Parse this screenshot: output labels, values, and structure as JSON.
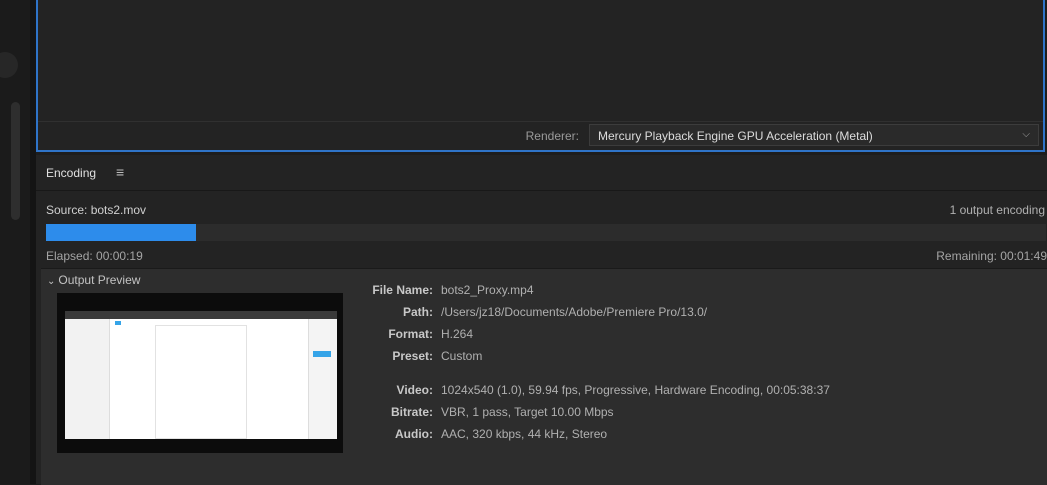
{
  "renderer": {
    "label": "Renderer:",
    "value": "Mercury Playback Engine GPU Acceleration (Metal)",
    "chevron_icon": "chevron-down-icon"
  },
  "encoding": {
    "title": "Encoding",
    "menu_icon": "hamburger-menu-icon",
    "source": "Source: bots2.mov",
    "output_count": "1 output encoding",
    "progress_fraction": 0.15,
    "progress_color": "#2d8ceb",
    "elapsed": "Elapsed: 00:00:19",
    "remaining": "Remaining: 00:01:49"
  },
  "output_preview": {
    "header": "Output Preview",
    "chevron_icon": "chevron-down-icon",
    "fields": [
      {
        "label": "File Name:",
        "value": "bots2_Proxy.mp4"
      },
      {
        "label": "Path:",
        "value": "/Users/jz18/Documents/Adobe/Premiere Pro/13.0/"
      },
      {
        "label": "Format:",
        "value": "H.264"
      },
      {
        "label": "Preset:",
        "value": "Custom"
      },
      {
        "label": "Video:",
        "value": "1024x540 (1.0), 59.94 fps, Progressive, Hardware Encoding, 00:05:38:37"
      },
      {
        "label": "Bitrate:",
        "value": "VBR, 1 pass, Target 10.00 Mbps"
      },
      {
        "label": "Audio:",
        "value": "AAC, 320 kbps, 44 kHz, Stereo"
      }
    ]
  }
}
